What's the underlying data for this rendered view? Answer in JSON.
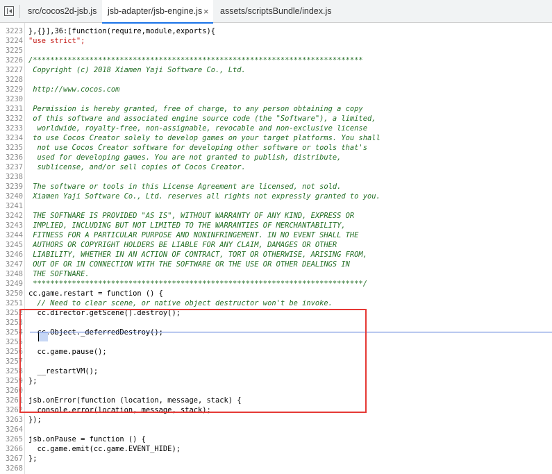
{
  "tabs": [
    {
      "label": "src/cocos2d-jsb.js",
      "active": false
    },
    {
      "label": "jsb-adapter/jsb-engine.js",
      "active": true
    },
    {
      "label": "assets/scriptsBundle/index.js",
      "active": false
    }
  ],
  "close_glyph": "×",
  "highlight_color": "#e53935",
  "lines": [
    {
      "n": "3223",
      "text": "},{}],36:[function(require,module,exports){"
    },
    {
      "n": "3224",
      "text": "\"use strict\";"
    },
    {
      "n": "3225",
      "text": ""
    },
    {
      "n": "3226",
      "text": "/****************************************************************************"
    },
    {
      "n": "3227",
      "text": " Copyright (c) 2018 Xiamen Yaji Software Co., Ltd."
    },
    {
      "n": "3228",
      "text": ""
    },
    {
      "n": "3229",
      "text": " http://www.cocos.com"
    },
    {
      "n": "3230",
      "text": ""
    },
    {
      "n": "3231",
      "text": " Permission is hereby granted, free of charge, to any person obtaining a copy"
    },
    {
      "n": "3232",
      "text": " of this software and associated engine source code (the \"Software\"), a limited,"
    },
    {
      "n": "3233",
      "text": "  worldwide, royalty-free, non-assignable, revocable and non-exclusive license"
    },
    {
      "n": "3234",
      "text": " to use Cocos Creator solely to develop games on your target platforms. You shall"
    },
    {
      "n": "3235",
      "text": "  not use Cocos Creator software for developing other software or tools that's"
    },
    {
      "n": "3236",
      "text": "  used for developing games. You are not granted to publish, distribute,"
    },
    {
      "n": "3237",
      "text": "  sublicense, and/or sell copies of Cocos Creator."
    },
    {
      "n": "3238",
      "text": ""
    },
    {
      "n": "3239",
      "text": " The software or tools in this License Agreement are licensed, not sold."
    },
    {
      "n": "3240",
      "text": " Xiamen Yaji Software Co., Ltd. reserves all rights not expressly granted to you."
    },
    {
      "n": "3241",
      "text": ""
    },
    {
      "n": "3242",
      "text": " THE SOFTWARE IS PROVIDED \"AS IS\", WITHOUT WARRANTY OF ANY KIND, EXPRESS OR"
    },
    {
      "n": "3243",
      "text": " IMPLIED, INCLUDING BUT NOT LIMITED TO THE WARRANTIES OF MERCHANTABILITY,"
    },
    {
      "n": "3244",
      "text": " FITNESS FOR A PARTICULAR PURPOSE AND NONINFRINGEMENT. IN NO EVENT SHALL THE"
    },
    {
      "n": "3245",
      "text": " AUTHORS OR COPYRIGHT HOLDERS BE LIABLE FOR ANY CLAIM, DAMAGES OR OTHER"
    },
    {
      "n": "3246",
      "text": " LIABILITY, WHETHER IN AN ACTION OF CONTRACT, TORT OR OTHERWISE, ARISING FROM,"
    },
    {
      "n": "3247",
      "text": " OUT OF OR IN CONNECTION WITH THE SOFTWARE OR THE USE OR OTHER DEALINGS IN"
    },
    {
      "n": "3248",
      "text": " THE SOFTWARE."
    },
    {
      "n": "3249",
      "text": " ****************************************************************************/"
    },
    {
      "n": "3250",
      "text": "cc.game.restart = function () {"
    },
    {
      "n": "3251",
      "text": "  // Need to clear scene, or native object destructor won't be invoke."
    },
    {
      "n": "3252",
      "text": "  cc.director.getScene().destroy();"
    },
    {
      "n": "3253",
      "text": ""
    },
    {
      "n": "3254",
      "text": "  cc.Object._deferredDestroy();"
    },
    {
      "n": "3255",
      "text": ""
    },
    {
      "n": "3256",
      "text": "  cc.game.pause();"
    },
    {
      "n": "3257",
      "text": ""
    },
    {
      "n": "3258",
      "text": "  __restartVM();"
    },
    {
      "n": "3259",
      "text": "};"
    },
    {
      "n": "3260",
      "text": ""
    },
    {
      "n": "3261",
      "text": "jsb.onError(function (location, message, stack) {"
    },
    {
      "n": "3262",
      "text": "  console.error(location, message, stack);"
    },
    {
      "n": "3263",
      "text": "});"
    },
    {
      "n": "3264",
      "text": ""
    },
    {
      "n": "3265",
      "text": "jsb.onPause = function () {"
    },
    {
      "n": "3266",
      "text": "  cc.game.emit(cc.game.EVENT_HIDE);"
    },
    {
      "n": "3267",
      "text": "};"
    },
    {
      "n": "3268",
      "text": ""
    }
  ]
}
